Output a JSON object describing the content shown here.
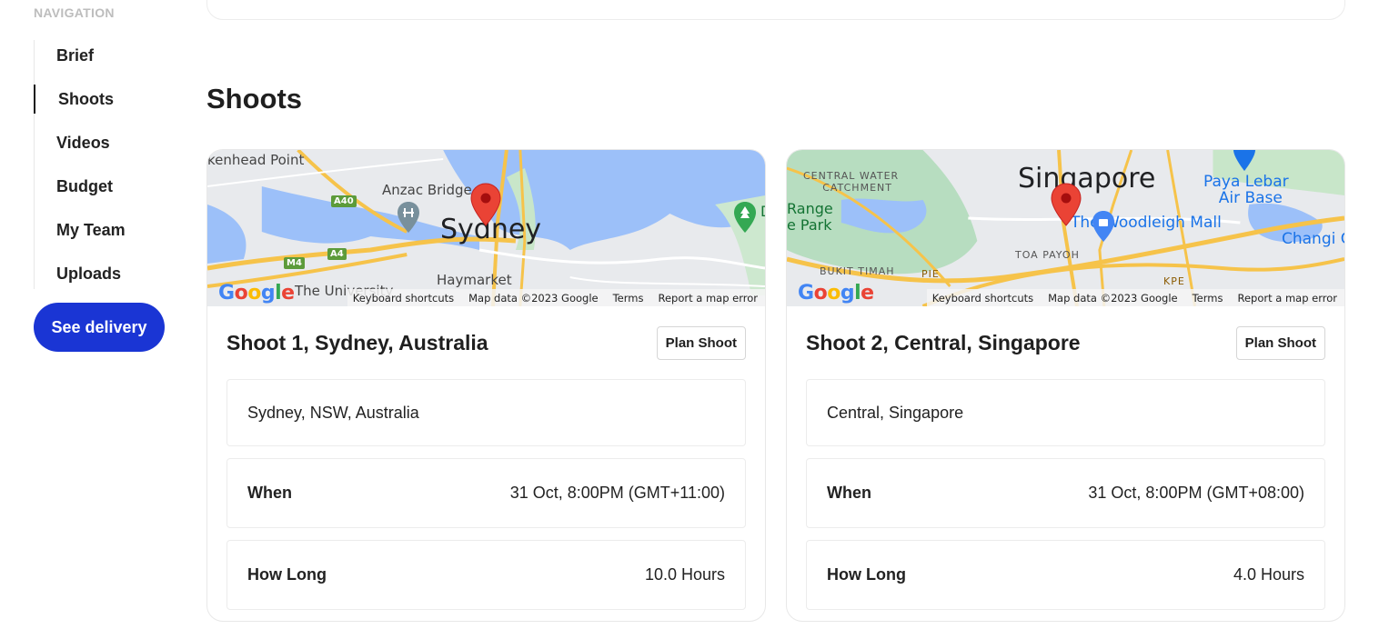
{
  "sidebar": {
    "heading": "NAVIGATION",
    "items": [
      {
        "label": "Brief",
        "active": false
      },
      {
        "label": "Shoots",
        "active": true
      },
      {
        "label": "Videos",
        "active": false
      },
      {
        "label": "Budget",
        "active": false
      },
      {
        "label": "My Team",
        "active": false
      },
      {
        "label": "Uploads",
        "active": false
      }
    ],
    "cta_label": "See delivery",
    "accent_color": "#1a35d4"
  },
  "section_title": "Shoots",
  "map_attribution": {
    "logo": "Google",
    "keyboard_shortcuts": "Keyboard shortcuts",
    "map_data": "Map data ©2023 Google",
    "terms": "Terms",
    "report": "Report a map error"
  },
  "shoots": [
    {
      "title": "Shoot 1, Sydney, Australia",
      "plan_label": "Plan Shoot",
      "location": "Sydney, NSW, Australia",
      "when_label": "When",
      "when_value": "31 Oct, 8:00PM (GMT+11:00)",
      "how_long_label": "How Long",
      "how_long_value": "10.0 Hours",
      "map": {
        "city": "Sydney",
        "labels": [
          "kenhead Point",
          "Anzac Bridge",
          "Haymarket",
          "The University",
          "D"
        ],
        "road_shields": [
          "A40",
          "A4",
          "M4"
        ]
      }
    },
    {
      "title": "Shoot 2, Central, Singapore",
      "plan_label": "Plan Shoot",
      "location": "Central, Singapore",
      "when_label": "When",
      "when_value": "31 Oct, 8:00PM (GMT+08:00)",
      "how_long_label": "How Long",
      "how_long_value": "4.0 Hours",
      "map": {
        "city": "Singapore",
        "labels": [
          "CENTRAL WATER",
          "CATCHMENT",
          "Range",
          "e Park",
          "Paya Lebar",
          "Air Base",
          "The Woodleigh Mall",
          "TOA PAYOH",
          "BUKIT TIMAH",
          "Changi C",
          "PIE",
          "KPE"
        ]
      }
    }
  ]
}
